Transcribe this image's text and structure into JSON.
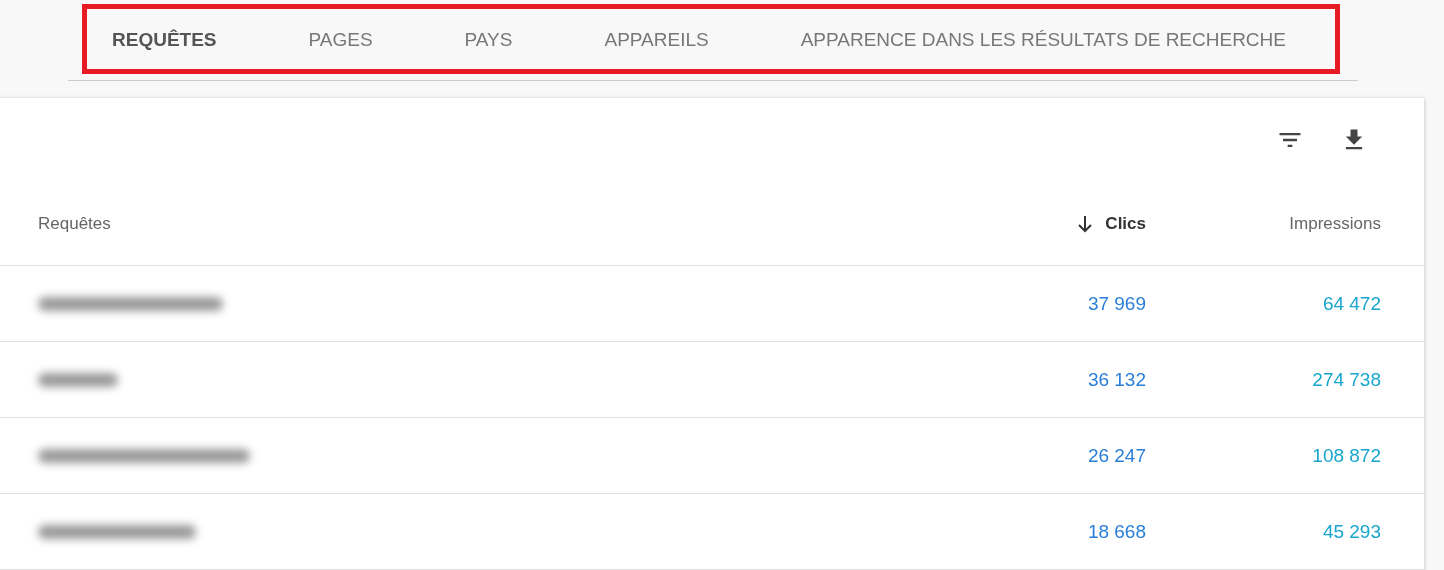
{
  "tabs": [
    {
      "label": "REQUÊTES",
      "selected": true
    },
    {
      "label": "PAGES",
      "selected": false
    },
    {
      "label": "PAYS",
      "selected": false
    },
    {
      "label": "APPAREILS",
      "selected": false
    },
    {
      "label": "APPARENCE DANS LES RÉSULTATS DE RECHERCHE",
      "selected": false
    }
  ],
  "table": {
    "columns": [
      {
        "label": "Requêtes",
        "sorted": false
      },
      {
        "label": "Clics",
        "sorted": true
      },
      {
        "label": "Impressions",
        "sorted": false
      }
    ],
    "rows": [
      {
        "query": {
          "kind": "blurred"
        },
        "clics": "37 969",
        "impressions": "64 472"
      },
      {
        "query": {
          "kind": "blurred"
        },
        "clics": "36 132",
        "impressions": "274 738"
      },
      {
        "query": {
          "kind": "blurred"
        },
        "clics": "26 247",
        "impressions": "108 872"
      },
      {
        "query": {
          "kind": "blurred"
        },
        "clics": "18 668",
        "impressions": "45 293"
      }
    ]
  }
}
